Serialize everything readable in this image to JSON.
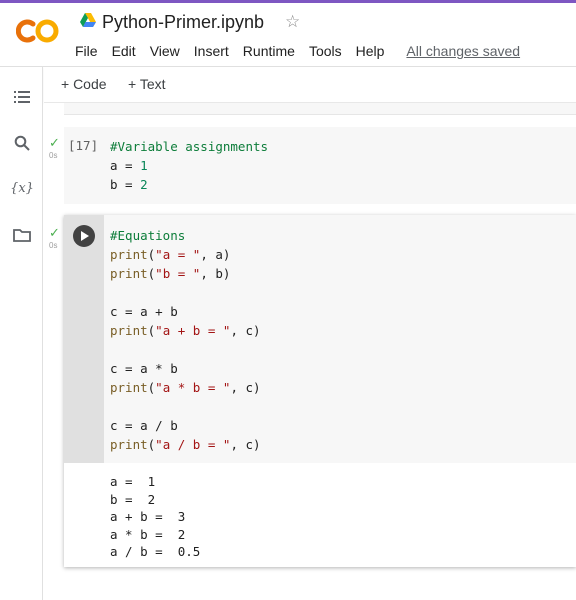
{
  "app": {
    "logo_text": "CO",
    "brand_colors": {
      "orange": "#f9ab00",
      "dark_orange": "#e8710a",
      "accent": "#7e57c2"
    },
    "notebook_title": "Python-Primer.ipynb",
    "star_icon": "star-outline-icon"
  },
  "menu": {
    "items": [
      "File",
      "Edit",
      "View",
      "Insert",
      "Runtime",
      "Tools",
      "Help"
    ],
    "save_status": "All changes saved"
  },
  "sidebar": {
    "icons": [
      "table-of-contents-icon",
      "search-icon",
      "variables-icon",
      "folder-icon"
    ],
    "variables_glyph": "{x}"
  },
  "toolbar": {
    "add_code_label": "+ Code",
    "add_text_label": "+ Text"
  },
  "cells": [
    {
      "execution_count": "[17]",
      "status_duration": "0s",
      "lines": [
        [
          {
            "t": "#Variable assignments",
            "k": "com"
          }
        ],
        [
          {
            "t": "a = ",
            "k": "op"
          },
          {
            "t": "1",
            "k": "num"
          }
        ],
        [
          {
            "t": "b = ",
            "k": "op"
          },
          {
            "t": "2",
            "k": "num"
          }
        ]
      ]
    },
    {
      "status_duration": "0s",
      "lines": [
        [
          {
            "t": "#Equations",
            "k": "com"
          }
        ],
        [
          {
            "t": "print",
            "k": "fn"
          },
          {
            "t": "(",
            "k": "op"
          },
          {
            "t": "\"a = \"",
            "k": "str"
          },
          {
            "t": ", a)",
            "k": "op"
          }
        ],
        [
          {
            "t": "print",
            "k": "fn"
          },
          {
            "t": "(",
            "k": "op"
          },
          {
            "t": "\"b = \"",
            "k": "str"
          },
          {
            "t": ", b)",
            "k": "op"
          }
        ],
        [],
        [
          {
            "t": "c = a + b",
            "k": "op"
          }
        ],
        [
          {
            "t": "print",
            "k": "fn"
          },
          {
            "t": "(",
            "k": "op"
          },
          {
            "t": "\"a + b = \"",
            "k": "str"
          },
          {
            "t": ", c)",
            "k": "op"
          }
        ],
        [],
        [
          {
            "t": "c = a * b",
            "k": "op"
          }
        ],
        [
          {
            "t": "print",
            "k": "fn"
          },
          {
            "t": "(",
            "k": "op"
          },
          {
            "t": "\"a * b = \"",
            "k": "str"
          },
          {
            "t": ", c)",
            "k": "op"
          }
        ],
        [],
        [
          {
            "t": "c = a / b",
            "k": "op"
          }
        ],
        [
          {
            "t": "print",
            "k": "fn"
          },
          {
            "t": "(",
            "k": "op"
          },
          {
            "t": "\"a / b = \"",
            "k": "str"
          },
          {
            "t": ", c)",
            "k": "op"
          }
        ]
      ],
      "output": [
        "a =  1",
        "b =  2",
        "a + b =  3",
        "a * b =  2",
        "a / b =  0.5"
      ]
    }
  ]
}
